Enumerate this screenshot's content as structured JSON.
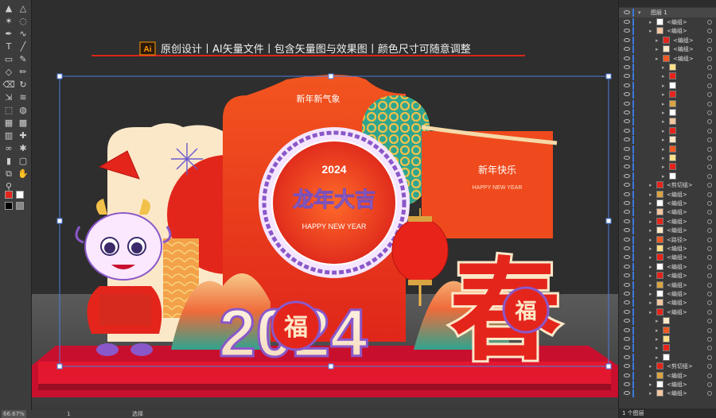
{
  "banner": {
    "ai_badge": "Ai",
    "text": "原创设计丨AI矢量文件丨包含矢量图与效果图丨颜色尺寸可随意调整"
  },
  "artwork": {
    "top_arch_text": "新年新气象",
    "circle_year": "2024",
    "circle_main": "龙年大吉",
    "circle_english": "HAPPY NEW YEAR",
    "right_title": "新年快乐",
    "right_english": "HAPPY NEW YEAR",
    "big_year": "2024",
    "fu_char": "福",
    "chun_char": "春"
  },
  "toolbar": {
    "icons": [
      "selection-tool",
      "direct-selection-tool",
      "magic-wand-tool",
      "lasso-tool",
      "pen-tool",
      "curvature-tool",
      "type-tool",
      "line-tool",
      "rectangle-tool",
      "paintbrush-tool",
      "shaper-tool",
      "pencil-tool",
      "eraser-tool",
      "rotate-tool",
      "scale-tool",
      "width-tool",
      "free-transform-tool",
      "shape-builder-tool",
      "perspective-tool",
      "mesh-tool",
      "gradient-tool",
      "eyedropper-tool",
      "blend-tool",
      "symbol-sprayer-tool",
      "column-graph-tool",
      "artboard-tool",
      "slice-tool",
      "hand-tool",
      "zoom-tool"
    ]
  },
  "layers_panel": {
    "layer_name": "图层 1",
    "rows": [
      {
        "label": "<编组>",
        "indent": 2
      },
      {
        "label": "<编组>",
        "indent": 2
      },
      {
        "label": "<编组>",
        "indent": 3
      },
      {
        "label": "<编组>",
        "indent": 3
      },
      {
        "label": "<编组>",
        "indent": 3
      },
      {
        "label": "",
        "indent": 4
      },
      {
        "label": "",
        "indent": 4
      },
      {
        "label": "",
        "indent": 4
      },
      {
        "label": "",
        "indent": 4
      },
      {
        "label": "",
        "indent": 4
      },
      {
        "label": "",
        "indent": 4
      },
      {
        "label": "",
        "indent": 4
      },
      {
        "label": "",
        "indent": 4
      },
      {
        "label": "",
        "indent": 4
      },
      {
        "label": "",
        "indent": 4
      },
      {
        "label": "",
        "indent": 4
      },
      {
        "label": "",
        "indent": 4
      },
      {
        "label": "",
        "indent": 4
      },
      {
        "label": "<剪切组>",
        "indent": 2
      },
      {
        "label": "<编组>",
        "indent": 2
      },
      {
        "label": "<编组>",
        "indent": 2
      },
      {
        "label": "<编组>",
        "indent": 2
      },
      {
        "label": "<编组>",
        "indent": 2
      },
      {
        "label": "<编组>",
        "indent": 2
      },
      {
        "label": "<路径>",
        "indent": 2
      },
      {
        "label": "<编组>",
        "indent": 2
      },
      {
        "label": "<编组>",
        "indent": 2
      },
      {
        "label": "<编组>",
        "indent": 2
      },
      {
        "label": "<编组>",
        "indent": 2
      },
      {
        "label": "<编组>",
        "indent": 2
      },
      {
        "label": "<编组>",
        "indent": 2
      },
      {
        "label": "<编组>",
        "indent": 2
      },
      {
        "label": "<编组>",
        "indent": 2
      },
      {
        "label": "",
        "indent": 3
      },
      {
        "label": "",
        "indent": 3
      },
      {
        "label": "",
        "indent": 3
      },
      {
        "label": "",
        "indent": 3
      },
      {
        "label": "",
        "indent": 3
      },
      {
        "label": "<剪切组>",
        "indent": 2
      },
      {
        "label": "<编组>",
        "indent": 2
      },
      {
        "label": "<编组>",
        "indent": 2
      },
      {
        "label": "<编组>",
        "indent": 2
      }
    ],
    "footer": "1 个图层"
  },
  "status": {
    "zoom": "66.67%",
    "page": "1",
    "mode": "选择"
  },
  "colors": {
    "bg": "#2e2e2e",
    "red": "#e4251c",
    "orange": "#f05a22",
    "cream": "#fbe8c8",
    "purple": "#7b4fb8",
    "gold": "#d9a441",
    "teal": "#2fa48f",
    "selection": "#4d7ee0"
  }
}
